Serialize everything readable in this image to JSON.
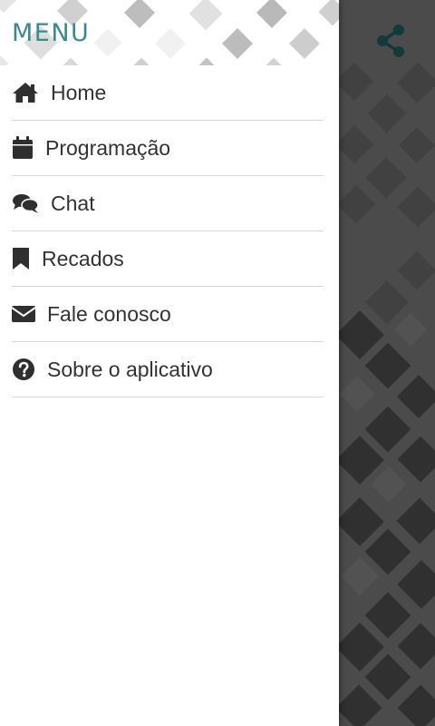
{
  "drawer": {
    "title": "MENU",
    "items": [
      {
        "label": "Home",
        "icon": "home-icon"
      },
      {
        "label": "Programação",
        "icon": "calendar-icon"
      },
      {
        "label": "Chat",
        "icon": "chat-bubbles-icon"
      },
      {
        "label": "Recados",
        "icon": "bookmark-icon"
      },
      {
        "label": "Fale conosco",
        "icon": "envelope-icon"
      },
      {
        "label": "Sobre o aplicativo",
        "icon": "question-circle-icon"
      }
    ]
  },
  "toolbar": {
    "share_icon": "share-icon"
  },
  "colors": {
    "menu_title": "#3a8a8f",
    "background": "#4b4b4b",
    "drawer": "#ffffff",
    "share_icon": "#123a3a"
  }
}
